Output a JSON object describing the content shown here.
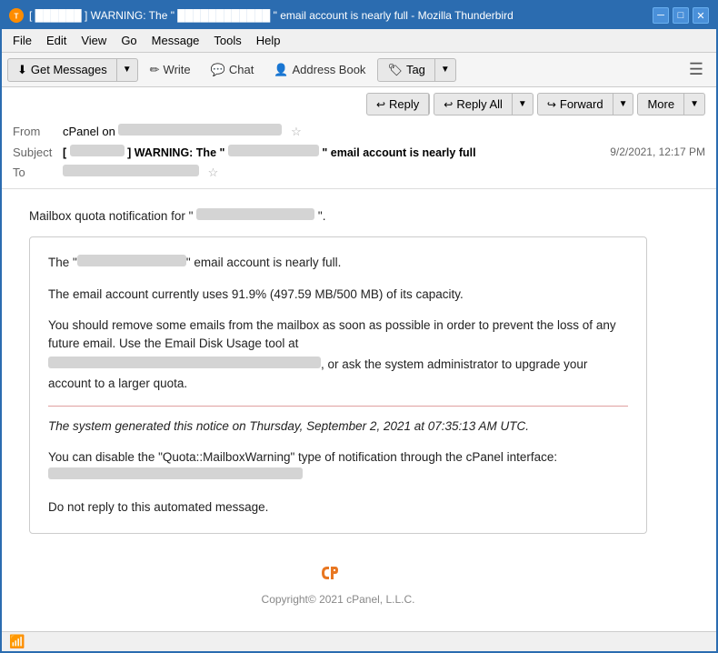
{
  "window": {
    "title": "WARNING: The email account is nearly full - Mozilla Thunderbird",
    "title_short": "[ ██████ ] WARNING: The \" ████████████ \" email account is nearly full - Mozilla Thunderbird"
  },
  "titlebar": {
    "icon_label": "TB",
    "minimize": "─",
    "maximize": "□",
    "close": "✕"
  },
  "menubar": {
    "items": [
      "File",
      "Edit",
      "View",
      "Go",
      "Message",
      "Tools",
      "Help"
    ]
  },
  "toolbar": {
    "get_messages": "Get Messages",
    "write": "Write",
    "chat": "Chat",
    "address_book": "Address Book",
    "tag": "Tag"
  },
  "action_buttons": {
    "reply": "Reply",
    "reply_all": "Reply All",
    "forward": "Forward",
    "more": "More"
  },
  "email_header": {
    "from_label": "From",
    "from_value": "cPanel on",
    "from_blurred": true,
    "subject_label": "Subject",
    "subject_value": "[ ████████ ] WARNING: The \" ████████████████ \" email account is nearly full",
    "to_label": "To",
    "to_blurred": true,
    "timestamp": "9/2/2021, 12:17 PM"
  },
  "email_body": {
    "intro": "Mailbox quota notification for \" ███████████████ \".",
    "message_lines": [
      "The \"██████████████\" email account is nearly full.",
      "The email account currently uses 91.9% (497.59 MB/500 MB) of its capacity.",
      "You should remove some emails from the mailbox as soon as possible in order to prevent the loss of any future email. Use the Email Disk Usage tool at",
      ", or ask the system administrator to upgrade your account to a larger quota.",
      "The system generated this notice on Thursday, September 2, 2021 at 07:35:13 AM UTC.",
      "You can disable the \"Quota::MailboxWarning\" type of notification through the cPanel interface:",
      "Do not reply to this automated message."
    ],
    "system_notice": "The system generated this notice on Thursday, September 2, 2021 at 07:35:13 AM UTC."
  },
  "footer": {
    "logo_symbol": "cP",
    "copyright": "Copyright© 2021 cPanel, L.L.C."
  },
  "statusbar": {
    "wifi_icon": "📶"
  }
}
